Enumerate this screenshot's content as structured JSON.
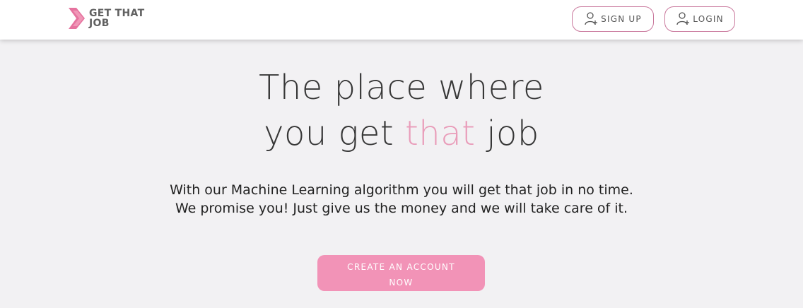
{
  "header": {
    "logo_text": "GET THAT JOB",
    "signup_label": "SIGN UP",
    "login_label": "LOGIN"
  },
  "hero": {
    "title_line1": "The place where",
    "title_line2_prefix": "you get ",
    "title_line2_accent": "that",
    "title_line2_suffix": " job",
    "subtitle": "With our Machine Learning algorithm you will get that job in no time. We promise you! Just give us the money and we will take care of it.",
    "cta_label": "CREATE AN ACCOUNT NOW"
  },
  "colors": {
    "accent": "#e99cb9",
    "cta_background": "#f293b7",
    "button_border": "#c9789c",
    "page_background": "#f2f1f3"
  },
  "icons": {
    "logo": "chevron-right-icon",
    "signup": "user-add-icon",
    "login": "user-add-icon"
  }
}
